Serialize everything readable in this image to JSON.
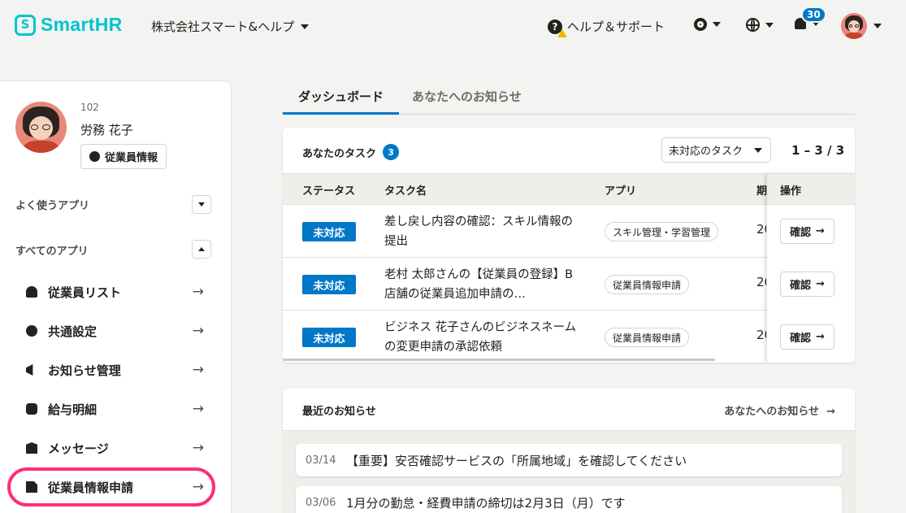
{
  "header": {
    "logo_text": "SmartHR",
    "logo_mark": "S",
    "company": "株式会社スマート&ヘルプ",
    "help_label": "ヘルプ＆サポート",
    "notification_count": "30",
    "brand_color": "#00c4cc"
  },
  "profile": {
    "number": "102",
    "name": "労務 花子",
    "info_button": "従業員情報"
  },
  "sidebar": {
    "favorites_label": "よく使うアプリ",
    "all_apps_label": "すべてのアプリ",
    "items": [
      {
        "label": "従業員リスト",
        "icon": "person-icon"
      },
      {
        "label": "共通設定",
        "icon": "gear-icon"
      },
      {
        "label": "お知らせ管理",
        "icon": "megaphone-icon"
      },
      {
        "label": "給与明細",
        "icon": "payslip-icon"
      },
      {
        "label": "メッセージ",
        "icon": "envelope-icon"
      },
      {
        "label": "従業員情報申請",
        "icon": "document-icon"
      }
    ],
    "arrow": "→"
  },
  "tabs": [
    {
      "label": "ダッシュボード",
      "active": true
    },
    {
      "label": "あなたへのお知らせ",
      "active": false
    }
  ],
  "tasks": {
    "title": "あなたのタスク",
    "count": "3",
    "filter": "未対応のタスク",
    "pager": "1 – 3 / 3",
    "columns": [
      "ステータス",
      "タスク名",
      "アプリ",
      "期",
      "操作"
    ],
    "rows": [
      {
        "status": "未対応",
        "name": "差し戻し内容の確認：スキル情報の提出",
        "app": "スキル管理・学習管理",
        "due": "20",
        "action": "確認"
      },
      {
        "status": "未対応",
        "name": "老村 太郎さんの【従業員の登録】B店舗の従業員追加申請の…",
        "app": "従業員情報申請",
        "due": "20",
        "action": "確認"
      },
      {
        "status": "未対応",
        "name": "ビジネス 花子さんのビジネスネームの変更申請の承認依頼",
        "app": "従業員情報申請",
        "due": "20",
        "action": "確認"
      }
    ],
    "status_color": "#0077c7"
  },
  "news": {
    "title": "最近のお知らせ",
    "link": "あなたへのお知らせ",
    "items": [
      {
        "date": "03/14",
        "text": "【重要】安否確認サービスの「所属地域」を確認してください"
      },
      {
        "date": "03/06",
        "text": "1月分の勤怠・経費申請の締切は2月3日（月）です"
      }
    ]
  }
}
